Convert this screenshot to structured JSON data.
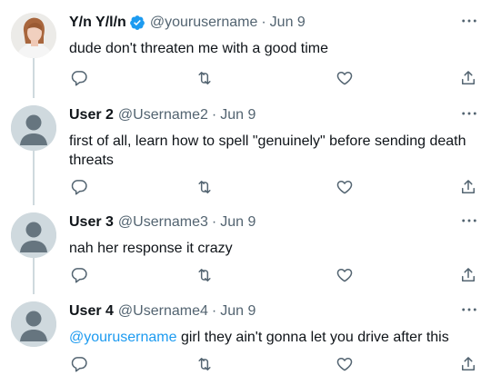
{
  "tweets": [
    {
      "name": "Y/n Y/l/n",
      "verified": true,
      "handle": "@yourusername",
      "date": "Jun 9",
      "text": "dude don't threaten me with a good time"
    },
    {
      "name": "User 2",
      "verified": false,
      "handle": "@Username2",
      "date": "Jun 9",
      "text": "first of all, learn how to spell \"genuinely\" before sending death threats"
    },
    {
      "name": "User 3",
      "verified": false,
      "handle": "@Username3",
      "date": "Jun 9",
      "text": "nah her response it crazy"
    },
    {
      "name": "User 4",
      "verified": false,
      "handle": "@Username4",
      "date": "Jun 9",
      "mention": "@yourusername",
      "text": " girl they ain't gonna let you drive after this"
    }
  ],
  "separator": "·",
  "colors": {
    "text": "#0f1419",
    "muted": "#536471",
    "accent": "#1d9bf0",
    "thread_line": "#cfd9de",
    "default_avatar_bg": "#cfd9de",
    "default_avatar_fg": "#66757f"
  },
  "icons": {
    "reply": "reply-icon",
    "retweet": "retweet-icon",
    "like": "heart-icon",
    "share": "share-icon",
    "more": "more-icon",
    "verified": "verified-badge-icon"
  }
}
